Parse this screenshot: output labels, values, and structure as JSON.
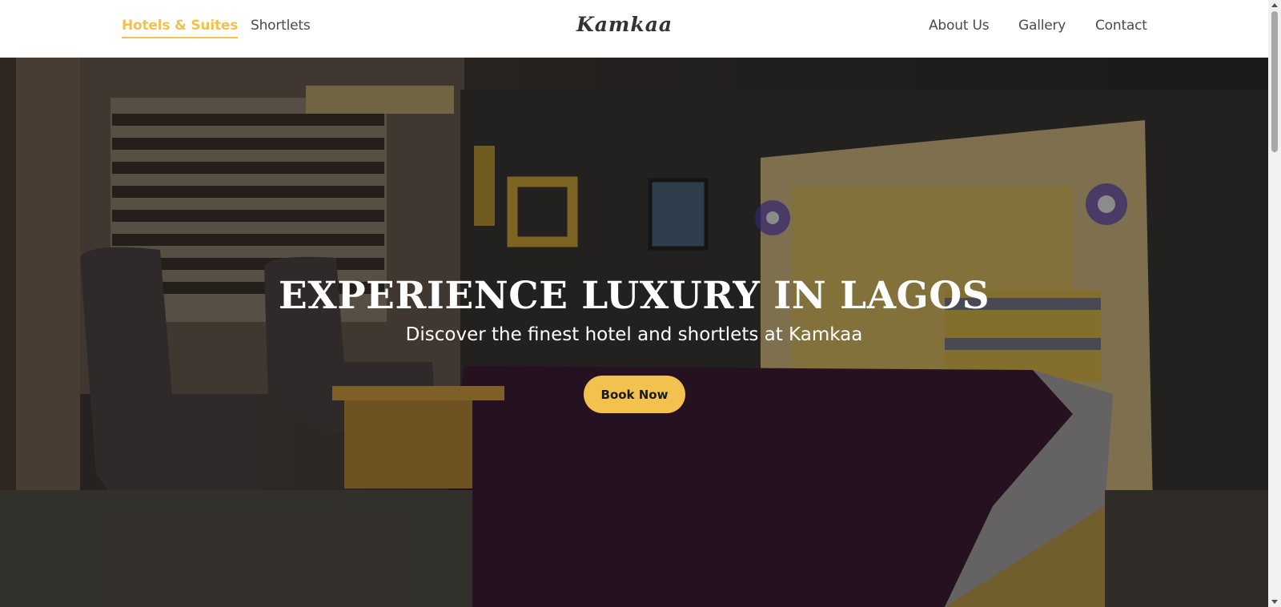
{
  "nav": {
    "left_links": [
      "Hotels & Suites",
      "Shortlets"
    ],
    "logo": "Kamkaa",
    "right_links": [
      "About Us",
      "Gallery",
      "Contact"
    ],
    "active_link": "Hotels & Suites"
  },
  "hero": {
    "title": "EXPERIENCE LUXURY IN LAGOS",
    "subtitle": "Discover the finest hotel and shortlets at Kamkaa",
    "button_label": "Book Now",
    "background_image": "hotel-room-photo"
  },
  "colors": {
    "accent": "#f2c14e",
    "nav_text": "#4a4a4a",
    "hero_text": "#ffffff"
  }
}
